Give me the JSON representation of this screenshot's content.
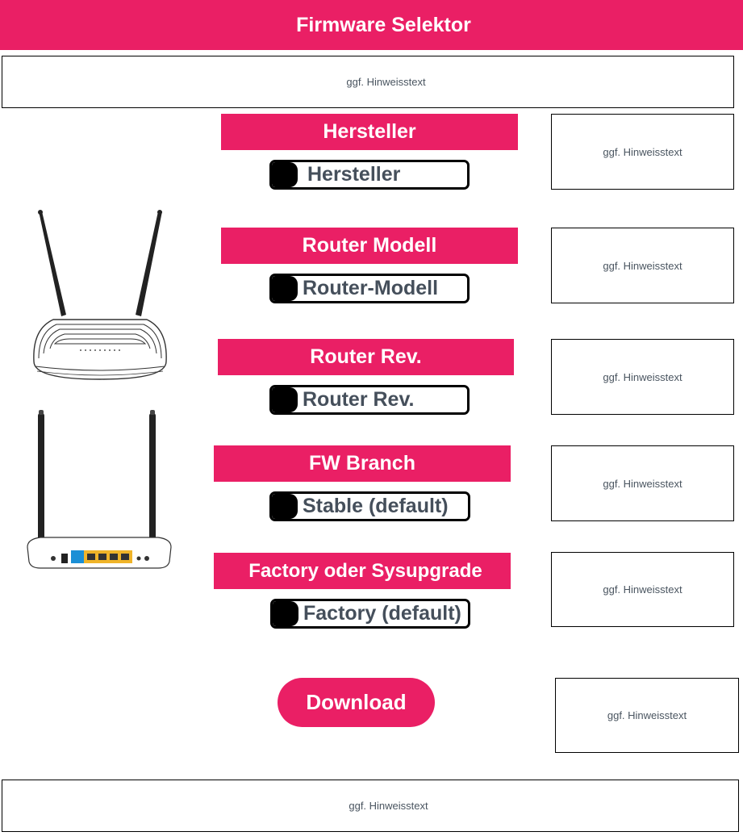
{
  "header": {
    "title": "Firmware Selektor"
  },
  "colors": {
    "accent": "#ea1f65",
    "select_text": "#454f5b",
    "hint_text": "#4a5560"
  },
  "hint_text": "ggf. Hinweisstext",
  "fields": [
    {
      "label": "Hersteller",
      "value": "Hersteller"
    },
    {
      "label": "Router Modell",
      "value": "Router-Modell"
    },
    {
      "label": "Router Rev.",
      "value": "Router Rev."
    },
    {
      "label": "FW Branch",
      "value": "Stable (default)"
    },
    {
      "label": "Factory oder Sysupgrade",
      "value": "Factory (default)"
    }
  ],
  "download": {
    "label": "Download"
  },
  "icons": {
    "router_front": "router-front-icon",
    "router_back": "router-back-icon"
  }
}
